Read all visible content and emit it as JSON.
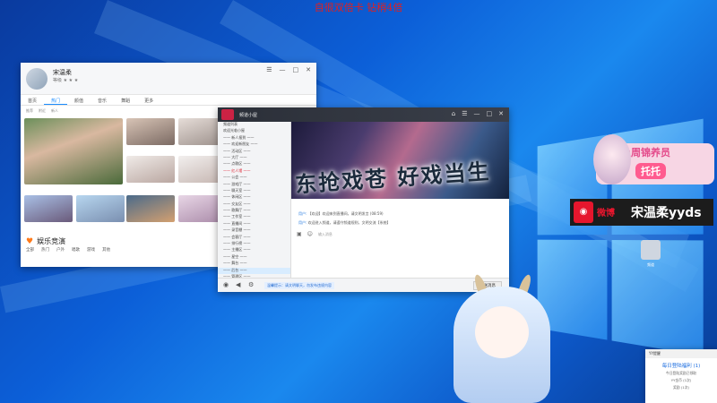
{
  "banner_top": "自很双倍卡 钻稍4倍",
  "window1": {
    "tabs": [
      "首页",
      "热门",
      "颜值",
      "音乐",
      "舞蹈",
      "更多"
    ],
    "active_tab": "热门",
    "sub_tabs": [
      "推荐",
      "附近",
      "新人"
    ],
    "section_title": "娱乐竞演",
    "chips": [
      "全部",
      "热门",
      "户外",
      "唱歌",
      "游戏",
      "其他"
    ]
  },
  "window2": {
    "side_rows": [
      {
        "text": "频道列表",
        "style": "normal"
      },
      {
        "text": "欢迎光临小屋",
        "style": "normal"
      },
      {
        "text": "—— 新人报到 ——",
        "style": "normal"
      },
      {
        "text": "—— 欢迎新朋友 ——",
        "style": "normal"
      },
      {
        "text": "—— 活动区 ——",
        "style": "normal"
      },
      {
        "text": "—— 大厅 ——",
        "style": "normal"
      },
      {
        "text": "—— 点歌区 ——",
        "style": "normal"
      },
      {
        "text": "—— 红人馆 ——",
        "style": "red"
      },
      {
        "text": "—— 公会 ——",
        "style": "normal"
      },
      {
        "text": "—— 游戏厅 ——",
        "style": "normal"
      },
      {
        "text": "—— 聊天室 ——",
        "style": "normal"
      },
      {
        "text": "—— 休闲区 ——",
        "style": "normal"
      },
      {
        "text": "—— 交友区 ——",
        "style": "normal"
      },
      {
        "text": "—— 歌舞厅 ——",
        "style": "normal"
      },
      {
        "text": "—— 工作室 ——",
        "style": "normal"
      },
      {
        "text": "—— 直播间 ——",
        "style": "normal"
      },
      {
        "text": "—— 录音棚 ——",
        "style": "normal"
      },
      {
        "text": "—— 会客厅 ——",
        "style": "normal"
      },
      {
        "text": "—— 排行榜 ——",
        "style": "normal"
      },
      {
        "text": "—— 主播区 ——",
        "style": "normal"
      },
      {
        "text": "—— 星空 ——",
        "style": "normal"
      },
      {
        "text": "—— 舞台 ——",
        "style": "normal"
      },
      {
        "text": "—— 后台 ——",
        "style": "hl"
      },
      {
        "text": "—— 管理区 ——",
        "style": "normal"
      },
      {
        "text": "—— 休息室 ——",
        "style": "normal"
      }
    ],
    "banner_text": "东抢戏苍 好戏当生",
    "chat_lines": [
      {
        "user": "用户:",
        "text": "【欢迎】欢迎来到直播间，请文明发言 (08:59)"
      },
      {
        "user": "用户:",
        "text": "欢迎进入频道，请遵守频道规则，文明交流【系统】"
      }
    ],
    "input_placeholder": "输入消息",
    "notice": "温馨提示：请文明聊天，勿发布违规内容",
    "send_label": "发送消息"
  },
  "overlay": {
    "badge_line1": "上周锦养员",
    "badge_line2": "托托",
    "weibo_label": "微博",
    "weibo_name": "宋温柔yyds",
    "desktop_icon_caption": "频道",
    "popup_title": "YY提醒",
    "popup_heading": "每日登陆福利 (1)",
    "popup_lines": [
      "今日登陆奖励已领取",
      "YY金币 (1次)",
      "奖励 (1次)"
    ]
  }
}
